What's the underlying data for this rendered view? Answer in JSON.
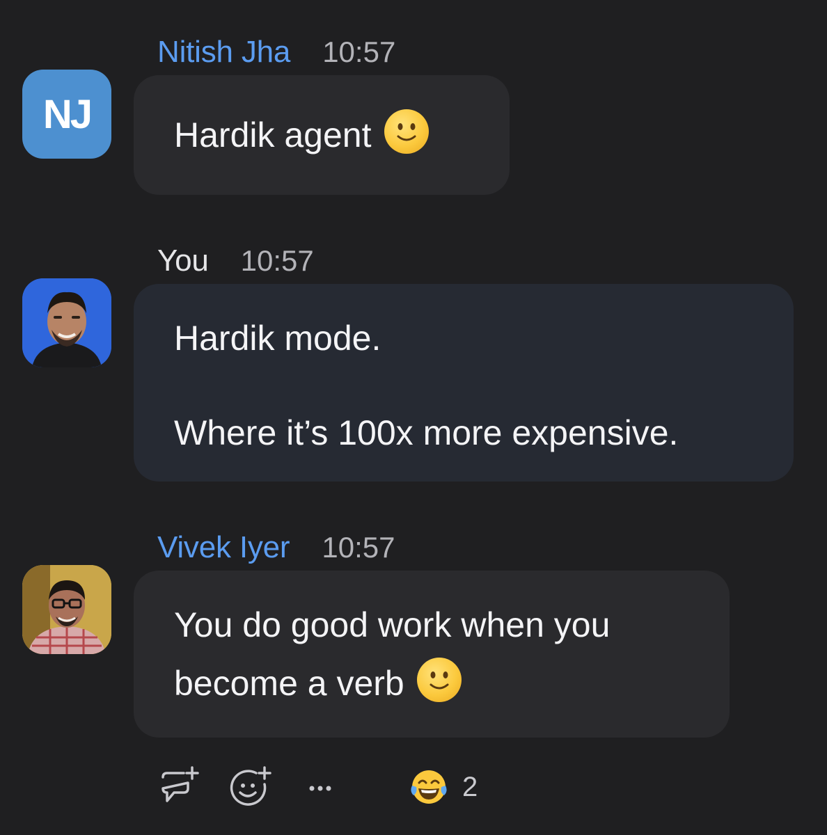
{
  "messages": [
    {
      "sender": "Nitish Jha",
      "time": "10:57",
      "avatar_initials": "NJ",
      "text": "Hardik agent",
      "emoji": "slightly-smiling-face"
    },
    {
      "sender": "You",
      "time": "10:57",
      "avatar": "user-photo",
      "line1": "Hardik mode.",
      "line2": "Where it’s 100x more expensive."
    },
    {
      "sender": "Vivek Iyer",
      "time": "10:57",
      "avatar": "user-photo",
      "line1": "You do good work when you",
      "line2": "become a verb",
      "emoji": "slightly-smiling-face"
    }
  ],
  "reactions": {
    "reply_in_thread_icon": "comment-plus-icon",
    "add_reaction_icon": "emoji-plus-icon",
    "more_icon": "ellipsis-icon",
    "existing": [
      {
        "emoji": "face-with-tears-of-joy",
        "count": "2"
      }
    ]
  },
  "colors": {
    "background": "#1f1f21",
    "link_name": "#5b9cf0",
    "bubble": "#2a2a2d",
    "own_bubble": "#262a33",
    "initials_avatar": "#4d90d0"
  }
}
